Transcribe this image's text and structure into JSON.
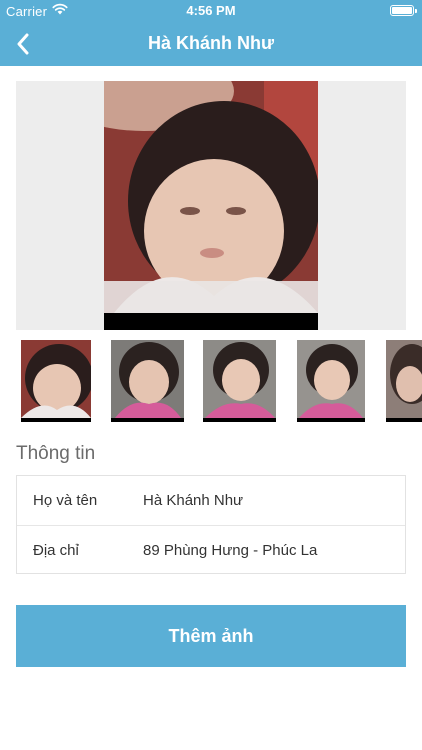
{
  "status_bar": {
    "carrier": "Carrier",
    "time": "4:56 PM",
    "wifi_icon": "wifi-icon",
    "battery_icon": "battery-icon"
  },
  "nav": {
    "back_icon": "chevron-left-icon",
    "title": "Hà Khánh Như"
  },
  "gallery": {
    "main_photo": "child-photo",
    "thumbnails": [
      "child-photo-1",
      "child-photo-2",
      "child-photo-3",
      "child-photo-4",
      "child-photo-5"
    ]
  },
  "info": {
    "section_title": "Thông tin",
    "rows": [
      {
        "label": "Họ và tên",
        "value": "Hà Khánh Như"
      },
      {
        "label": "Địa chỉ",
        "value": "89 Phùng Hưng - Phúc La"
      }
    ]
  },
  "actions": {
    "add_photo_label": "Thêm ảnh"
  },
  "colors": {
    "primary": "#5aafd6",
    "section_title": "#6b6b6b",
    "photo_background": "#ededed"
  }
}
